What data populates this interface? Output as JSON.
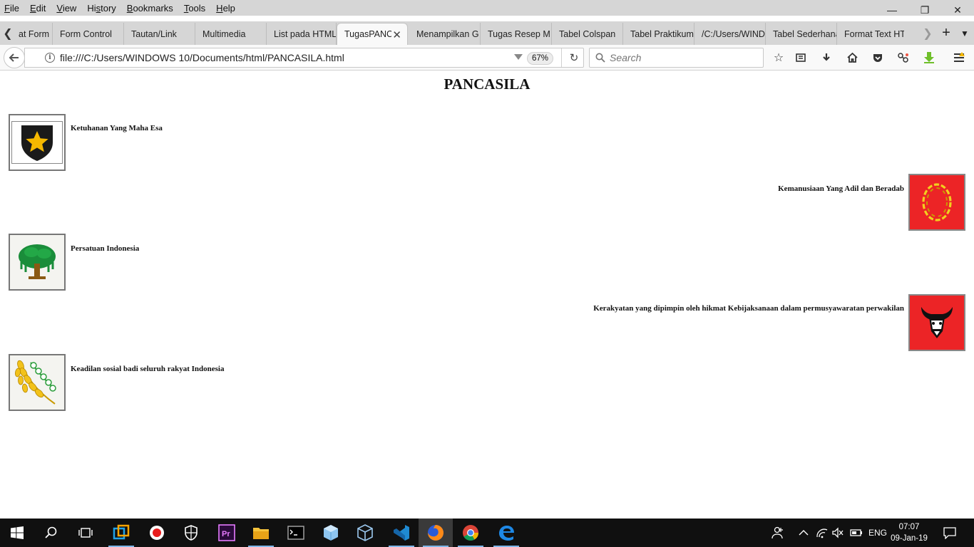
{
  "menubar": {
    "items": [
      "File",
      "Edit",
      "View",
      "History",
      "Bookmarks",
      "Tools",
      "Help"
    ],
    "access_keys": [
      "F",
      "E",
      "V",
      "s",
      "B",
      "T",
      "H"
    ]
  },
  "window_controls": {
    "minimize": "—",
    "restore": "❐",
    "close": "✕"
  },
  "tabs": [
    {
      "label": "at Form"
    },
    {
      "label": "Form Control"
    },
    {
      "label": "Tautan/Link"
    },
    {
      "label": "Multimedia"
    },
    {
      "label": "List pada HTML"
    },
    {
      "label": "TugasPANCASILA",
      "active": true
    },
    {
      "label": "Menampilkan G"
    },
    {
      "label": "Tugas Resep M"
    },
    {
      "label": "Tabel Colspan"
    },
    {
      "label": "Tabel Praktikum"
    },
    {
      "label": "/C:/Users/WIND"
    },
    {
      "label": "Tabel Sederhana"
    },
    {
      "label": "Format Text HTML"
    }
  ],
  "navbar": {
    "url": "file:///C:/Users/WINDOWS 10/Documents/html/PANCASILA.html",
    "zoom": "67%",
    "search_placeholder": "Search"
  },
  "page": {
    "title": "PANCASILA",
    "sila": [
      {
        "text": "Ketuhanan Yang Maha Esa",
        "symbol": "star-shield-icon",
        "align": "left"
      },
      {
        "text": "Kemanusiaan Yang Adil dan Beradab",
        "symbol": "chain-icon",
        "align": "right"
      },
      {
        "text": "Persatuan Indonesia",
        "symbol": "banyan-tree-icon",
        "align": "left"
      },
      {
        "text": "Kerakyatan yang dipimpin oleh hikmat Kebijaksanaan dalam permusyawaratan perwakilan",
        "symbol": "bull-head-icon",
        "align": "right"
      },
      {
        "text": "Keadilan sosial badi seluruh rakyat Indonesia",
        "symbol": "rice-cotton-icon",
        "align": "left"
      }
    ]
  },
  "taskbar": {
    "language": "ENG",
    "time": "07:07",
    "date": "09-Jan-19"
  },
  "colors": {
    "tab_strip": "#d6d6d6",
    "taskbar": "#101010",
    "sila_red": "#ec2426",
    "star_gold": "#f5b800"
  }
}
